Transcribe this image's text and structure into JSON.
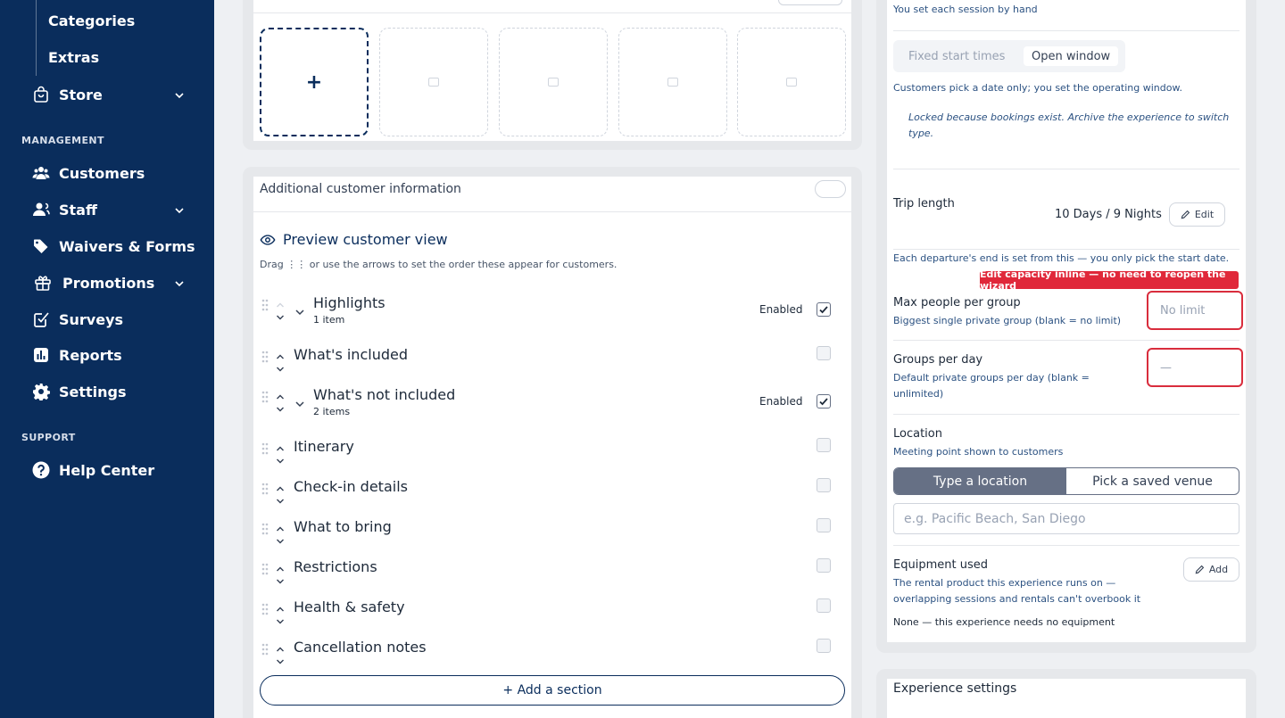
{
  "sidebar": {
    "sub_items": [
      "Categories",
      "Extras"
    ],
    "store": "Store",
    "management_label": "MANAGEMENT",
    "customers": "Customers",
    "staff": "Staff",
    "waivers": "Waivers & Forms",
    "promotions": "Promotions",
    "surveys": "Surveys",
    "reports": "Reports",
    "settings": "Settings",
    "support_label": "SUPPORT",
    "help_center": "Help Center"
  },
  "photos": {
    "add_symbol": "+"
  },
  "customer_info": {
    "label": "Additional customer information",
    "preview_link": "Preview customer view",
    "drag_hint": "Drag ⋮⋮ or use the arrows to set the order these appear for customers.",
    "enabled_label": "Enabled",
    "sections": [
      {
        "title": "Highlights",
        "sub": "1 item",
        "enabled": true
      },
      {
        "title": "What's included",
        "sub": "",
        "enabled": false
      },
      {
        "title": "What's not included",
        "sub": "2 items",
        "enabled": true
      },
      {
        "title": "Itinerary",
        "sub": "",
        "enabled": false
      },
      {
        "title": "Check-in details",
        "sub": "",
        "enabled": false
      },
      {
        "title": "What to bring",
        "sub": "",
        "enabled": false
      },
      {
        "title": "Restrictions",
        "sub": "",
        "enabled": false
      },
      {
        "title": "Health & safety",
        "sub": "",
        "enabled": false
      },
      {
        "title": "Cancellation notes",
        "sub": "",
        "enabled": false
      }
    ],
    "add_section": "+ Add a section"
  },
  "schedule": {
    "hand_note": "You set each session by hand",
    "opt_fixed": "Fixed start times",
    "opt_open": "Open window",
    "open_desc": "Customers pick a date only; you set the operating window.",
    "locked_note": "Locked because bookings exist. Archive the experience to switch type."
  },
  "trip": {
    "label": "Trip length",
    "value": "10 Days / 9 Nights",
    "edit": "Edit",
    "desc": "Each departure's end is set from this — you only pick the start date."
  },
  "capacity": {
    "tooltip": "Edit capacity inline — no need to reopen the wizard",
    "max_label": "Max people per group",
    "max_desc": "Biggest single private group (blank = no limit)",
    "max_placeholder": "No limit",
    "groups_label": "Groups per day",
    "groups_desc": "Default private groups per day (blank = unlimited)",
    "groups_placeholder": "—"
  },
  "location": {
    "label": "Location",
    "desc": "Meeting point shown to customers",
    "opt_type": "Type a location",
    "opt_saved": "Pick a saved venue",
    "placeholder": "e.g. Pacific Beach, San Diego"
  },
  "equipment": {
    "label": "Equipment used",
    "desc": "The rental product this experience runs on — overlapping sessions and rentals can't overbook it",
    "add": "Add",
    "none": "None — this experience needs no equipment"
  },
  "experience_settings": "Experience settings",
  "colors": {
    "navy": "#0a2d5c",
    "error": "#d92d3d",
    "link": "#2c5282"
  }
}
